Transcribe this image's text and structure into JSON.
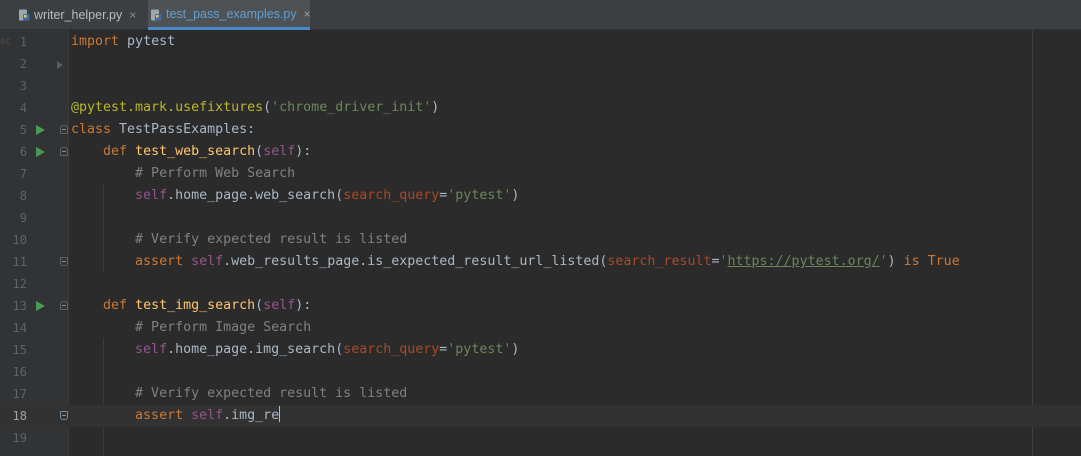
{
  "tabs": [
    {
      "label": "writer_helper.py",
      "close": "×",
      "active": false,
      "icon": "python-file-icon"
    },
    {
      "label": "test_pass_examples.py",
      "close": "×",
      "active": true,
      "icon": "python-file-icon"
    }
  ],
  "gutter_edge_char": "sc",
  "lines": [
    {
      "n": "1",
      "tokens": [
        {
          "t": "import",
          "c": "kw"
        },
        {
          "t": " pytest"
        }
      ]
    },
    {
      "n": "2",
      "tokens": []
    },
    {
      "n": "3",
      "tokens": []
    },
    {
      "n": "4",
      "tokens": [
        {
          "t": "@pytest.mark.usefixtures",
          "c": "deco"
        },
        {
          "t": "("
        },
        {
          "t": "'chrome_driver_init'",
          "c": "str"
        },
        {
          "t": ")"
        }
      ]
    },
    {
      "n": "5",
      "tokens": [
        {
          "t": "class",
          "c": "kw"
        },
        {
          "t": " TestPassExamples:"
        }
      ]
    },
    {
      "n": "6",
      "tokens": [
        {
          "t": "    "
        },
        {
          "t": "def",
          "c": "kw"
        },
        {
          "t": " "
        },
        {
          "t": "test_web_search",
          "c": "fn"
        },
        {
          "t": "("
        },
        {
          "t": "self",
          "c": "selfkw"
        },
        {
          "t": "):"
        }
      ]
    },
    {
      "n": "7",
      "tokens": [
        {
          "t": "        "
        },
        {
          "t": "# Perform Web Search",
          "c": "cm"
        }
      ]
    },
    {
      "n": "8",
      "tokens": [
        {
          "t": "        "
        },
        {
          "t": "self",
          "c": "selfkw"
        },
        {
          "t": ".home_page.web_search("
        },
        {
          "t": "search_query",
          "c": "param"
        },
        {
          "t": "="
        },
        {
          "t": "'pytest'",
          "c": "str"
        },
        {
          "t": ")"
        }
      ]
    },
    {
      "n": "9",
      "tokens": []
    },
    {
      "n": "10",
      "tokens": [
        {
          "t": "        "
        },
        {
          "t": "# Verify expected result is listed",
          "c": "cm"
        }
      ]
    },
    {
      "n": "11",
      "tokens": [
        {
          "t": "        "
        },
        {
          "t": "assert",
          "c": "kw"
        },
        {
          "t": " "
        },
        {
          "t": "self",
          "c": "selfkw"
        },
        {
          "t": ".web_results_page.is_expected_result_url_listed("
        },
        {
          "t": "search_result",
          "c": "param"
        },
        {
          "t": "="
        },
        {
          "t": "'",
          "c": "str"
        },
        {
          "t": "https://pytest.org/",
          "c": "url"
        },
        {
          "t": "'",
          "c": "str"
        },
        {
          "t": ") "
        },
        {
          "t": "is True",
          "c": "kw"
        }
      ]
    },
    {
      "n": "12",
      "tokens": []
    },
    {
      "n": "13",
      "tokens": [
        {
          "t": "    "
        },
        {
          "t": "def",
          "c": "kw"
        },
        {
          "t": " "
        },
        {
          "t": "test_img_search",
          "c": "fn"
        },
        {
          "t": "("
        },
        {
          "t": "self",
          "c": "selfkw"
        },
        {
          "t": "):"
        }
      ]
    },
    {
      "n": "14",
      "tokens": [
        {
          "t": "        "
        },
        {
          "t": "# Perform Image Search",
          "c": "cm"
        }
      ]
    },
    {
      "n": "15",
      "tokens": [
        {
          "t": "        "
        },
        {
          "t": "self",
          "c": "selfkw"
        },
        {
          "t": ".home_page.img_search("
        },
        {
          "t": "search_query",
          "c": "param"
        },
        {
          "t": "="
        },
        {
          "t": "'pytest'",
          "c": "str"
        },
        {
          "t": ")"
        }
      ]
    },
    {
      "n": "16",
      "tokens": []
    },
    {
      "n": "17",
      "tokens": [
        {
          "t": "        "
        },
        {
          "t": "# Verify expected result is listed",
          "c": "cm"
        }
      ]
    },
    {
      "n": "18",
      "tokens": [
        {
          "t": "        "
        },
        {
          "t": "assert",
          "c": "kw"
        },
        {
          "t": " "
        },
        {
          "t": "self",
          "c": "selfkw"
        },
        {
          "t": ".img_re"
        }
      ],
      "current": true
    },
    {
      "n": "19",
      "tokens": []
    }
  ],
  "run_lines": [
    "5",
    "6",
    "13"
  ],
  "fold_lines": {
    "5": "start",
    "6": "start",
    "11": "end",
    "13": "start",
    "18": "end"
  },
  "fold_arrow_line": "2",
  "colors": {
    "background": "#2b2b2b",
    "keyword": "#cc7832",
    "string": "#6a8759",
    "comment": "#808080",
    "function": "#ffc66d",
    "self": "#94558d",
    "decorator": "#bbb529",
    "run": "#499c54"
  }
}
